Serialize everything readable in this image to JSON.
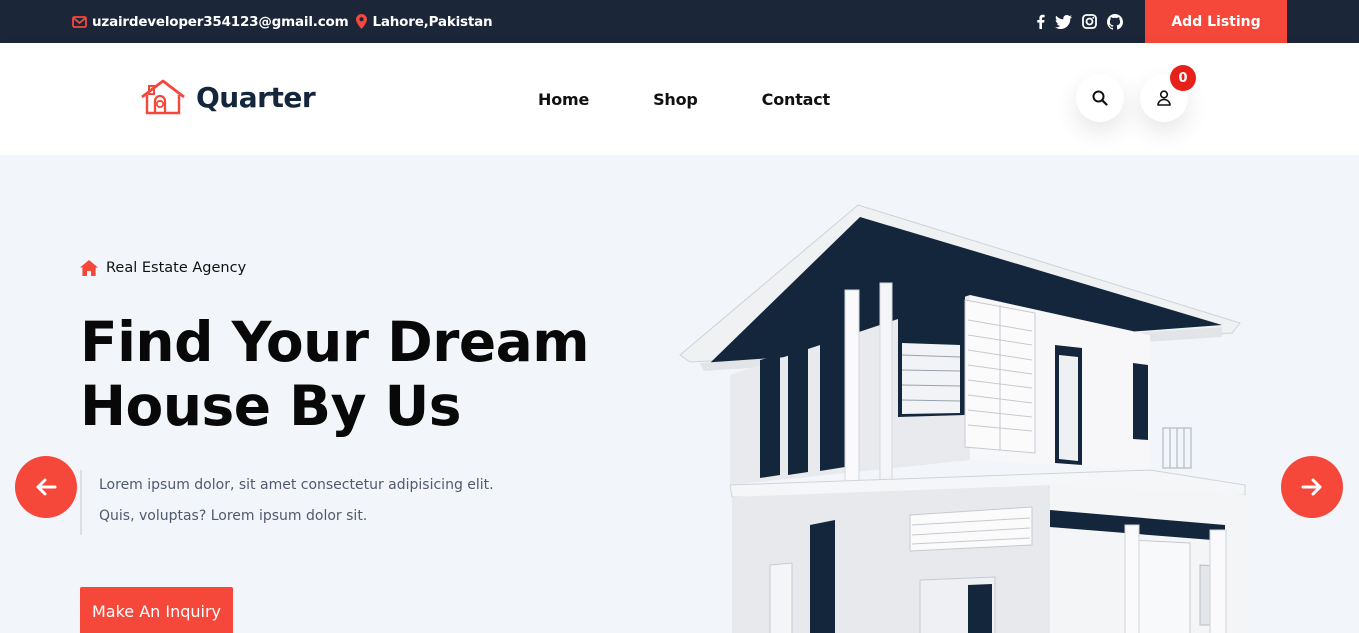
{
  "topbar": {
    "email": "uzairdeveloper354123@gmail.com",
    "location": "Lahore,Pakistan",
    "social_icons": [
      "facebook-icon",
      "twitter-icon",
      "instagram-icon",
      "github-icon"
    ],
    "add_listing_label": "Add Listing"
  },
  "header": {
    "logo_text": "Quarter",
    "nav": [
      "Home",
      "Shop",
      "Contact"
    ],
    "cart_count": "0"
  },
  "hero": {
    "kicker": "Real Estate Agency",
    "title_line1": "Find Your Dream",
    "title_line2": "House By Us",
    "desc_line1": "Lorem ipsum dolor, sit amet consectetur adipisicing elit.",
    "desc_line2": "Quis, voluptas? Lorem ipsum dolor sit.",
    "cta_label": "Make An Inquiry"
  },
  "colors": {
    "accent": "#f5473a",
    "topbar_bg": "#1b2638",
    "navy": "#13263b",
    "hero_bg": "#f2f5f9"
  }
}
